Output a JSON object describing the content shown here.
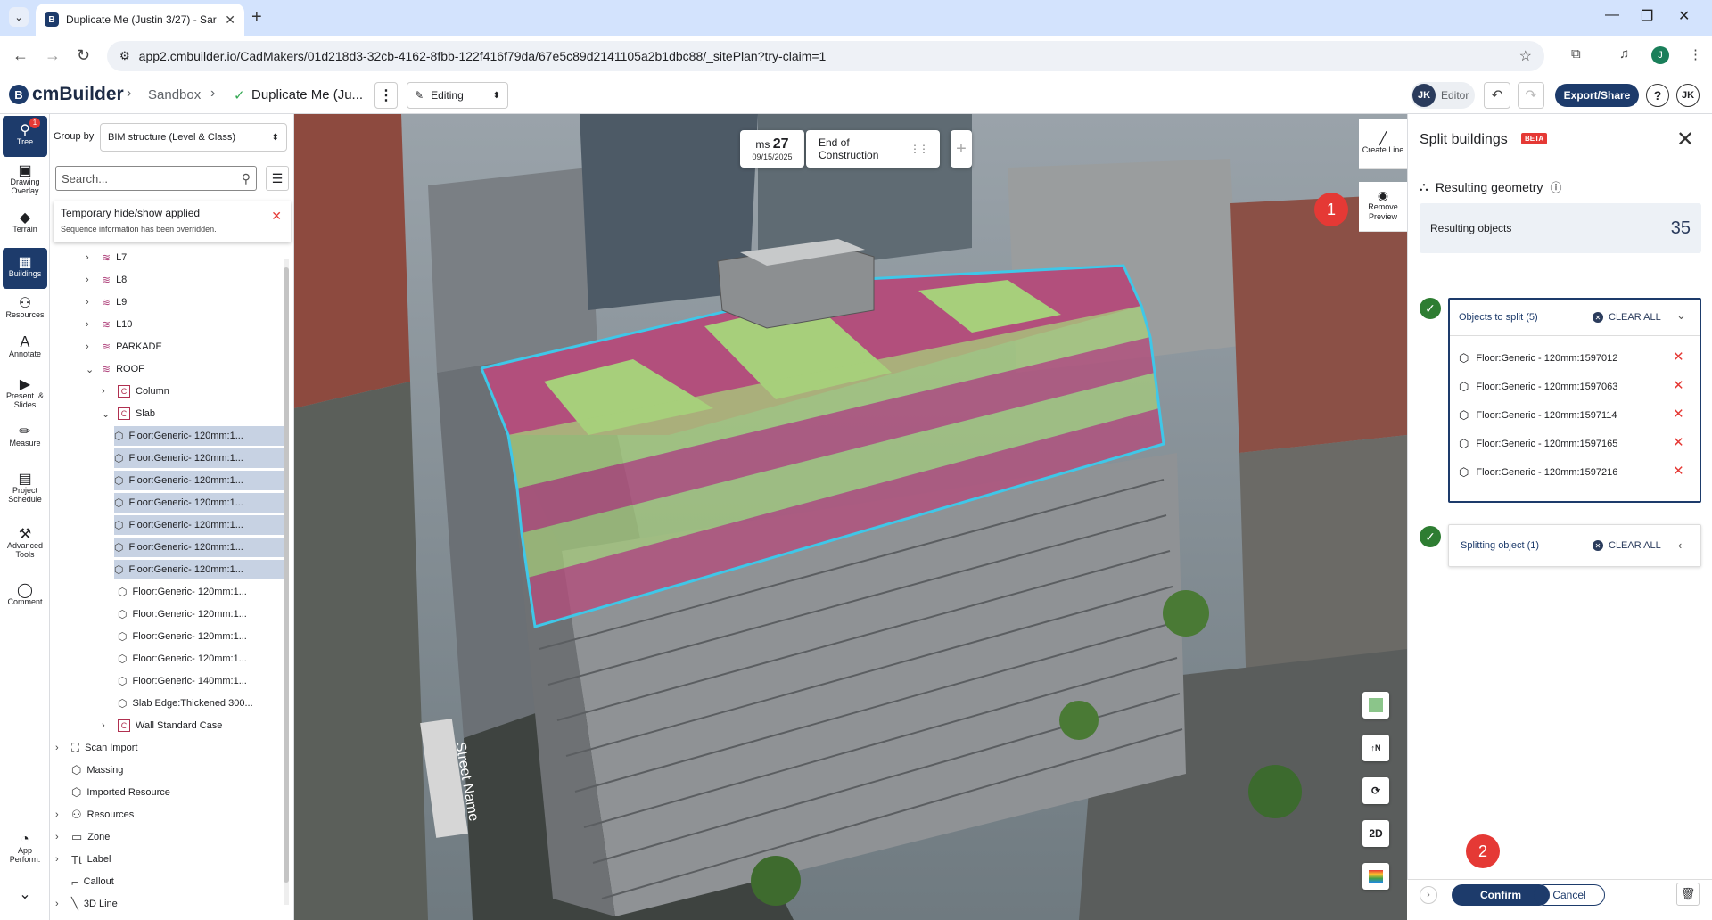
{
  "browser": {
    "tab_title": "Duplicate Me (Justin 3/27) - Sar",
    "url": "app2.cmbuilder.io/CadMakers/01d218d3-32cb-4162-8fbb-122f416f79da/67e5c89d2141105a2b1dbc88/_sitePlan?try-claim=1",
    "profile_initial": "J"
  },
  "app": {
    "logo_text": "cmBuilder",
    "breadcrumb_sandbox": "Sandbox",
    "breadcrumb_project": "Duplicate Me (Ju...",
    "mode": "Editing",
    "user_initials": "JK",
    "user_role": "Editor",
    "export_label": "Export/Share",
    "help_label": "?"
  },
  "rail": {
    "items": [
      {
        "label": "Tree",
        "icon": "tree-icon",
        "badge": "1"
      },
      {
        "label": "Drawing Overlay",
        "icon": "drawing-overlay-icon"
      },
      {
        "label": "Terrain",
        "icon": "terrain-icon"
      },
      {
        "label": "Buildings",
        "icon": "buildings-icon"
      },
      {
        "label": "Resources",
        "icon": "resources-icon"
      },
      {
        "label": "Annotate",
        "icon": "annotate-icon"
      },
      {
        "label": "Present. & Slides",
        "icon": "present-icon"
      },
      {
        "label": "Measure",
        "icon": "measure-icon"
      },
      {
        "label": "Project Schedule",
        "icon": "schedule-icon"
      },
      {
        "label": "Advanced Tools",
        "icon": "advanced-tools-icon"
      },
      {
        "label": "Comment",
        "icon": "comment-icon"
      },
      {
        "label": "App Perform.",
        "icon": "app-perf-icon"
      }
    ]
  },
  "tree": {
    "group_by_label": "Group by",
    "group_by_value": "BIM structure (Level & Class)",
    "search_placeholder": "Search...",
    "notice_title": "Temporary hide/show applied",
    "notice_body": "Sequence information has been overridden.",
    "rows": [
      {
        "label": "L7"
      },
      {
        "label": "L8"
      },
      {
        "label": "L9"
      },
      {
        "label": "L10"
      },
      {
        "label": "PARKADE"
      },
      {
        "label": "ROOF"
      },
      {
        "label": "Column"
      },
      {
        "label": "Slab"
      },
      {
        "label": "Floor:Generic- 120mm:1..."
      },
      {
        "label": "Floor:Generic- 120mm:1..."
      },
      {
        "label": "Floor:Generic- 120mm:1..."
      },
      {
        "label": "Floor:Generic- 120mm:1..."
      },
      {
        "label": "Floor:Generic- 120mm:1..."
      },
      {
        "label": "Floor:Generic- 120mm:1..."
      },
      {
        "label": "Floor:Generic- 120mm:1..."
      },
      {
        "label": "Floor:Generic- 120mm:1..."
      },
      {
        "label": "Floor:Generic- 120mm:1..."
      },
      {
        "label": "Floor:Generic- 120mm:1..."
      },
      {
        "label": "Floor:Generic- 120mm:1..."
      },
      {
        "label": "Floor:Generic- 140mm:1..."
      },
      {
        "label": "Slab Edge:Thickened 300..."
      },
      {
        "label": "Wall Standard Case"
      },
      {
        "label": "Scan Import"
      },
      {
        "label": "Massing"
      },
      {
        "label": "Imported Resource"
      },
      {
        "label": "Resources"
      },
      {
        "label": "Zone"
      },
      {
        "label": "Label"
      },
      {
        "label": "Callout"
      },
      {
        "label": "3D Line"
      }
    ]
  },
  "viewport": {
    "milestone_prefix": "ms",
    "milestone_day": "27",
    "milestone_date": "09/15/2025",
    "milestone_name": "End of Construction",
    "tools": [
      {
        "label": "Create Line"
      },
      {
        "label": "Remove Preview"
      }
    ],
    "street_label": "Street Name",
    "view_2d": "2D",
    "marker_1": "1",
    "marker_2": "2",
    "colors": {
      "pink": "#b24f7c",
      "green": "#a7cf7b",
      "outline": "#3fc7e8"
    }
  },
  "split_panel": {
    "title": "Split buildings",
    "beta": "BETA",
    "resulting_geometry": "Resulting geometry",
    "resulting_objects_label": "Resulting objects",
    "resulting_objects_count": "35",
    "objects_to_split_title": "Objects to split (5)",
    "clear_all": "CLEAR ALL",
    "objects": [
      "Floor:Generic - 120mm:1597012",
      "Floor:Generic - 120mm:1597063",
      "Floor:Generic - 120mm:1597114",
      "Floor:Generic - 120mm:1597165",
      "Floor:Generic - 120mm:1597216"
    ],
    "splitting_object_title": "Splitting object (1)",
    "confirm": "Confirm",
    "cancel": "Cancel"
  }
}
